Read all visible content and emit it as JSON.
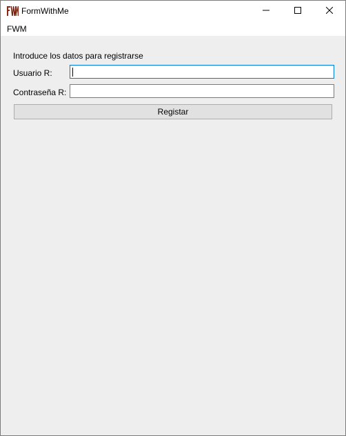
{
  "window": {
    "title": "FormWithMe",
    "icon": "fwm-logo-icon",
    "controls": [
      "minimize-icon",
      "maximize-icon",
      "close-icon"
    ]
  },
  "menu": {
    "items": [
      {
        "label": "FWM"
      }
    ]
  },
  "form": {
    "intro": "Introduce los datos para registrarse",
    "username_label": "Usuario R:",
    "username_value": "",
    "password_label": "Contraseña R:",
    "password_value": "",
    "submit_label": "Registar"
  },
  "colors": {
    "focus_border": "#0078d7",
    "client_bg": "#eeeeee",
    "button_bg": "#e1e1e1"
  }
}
